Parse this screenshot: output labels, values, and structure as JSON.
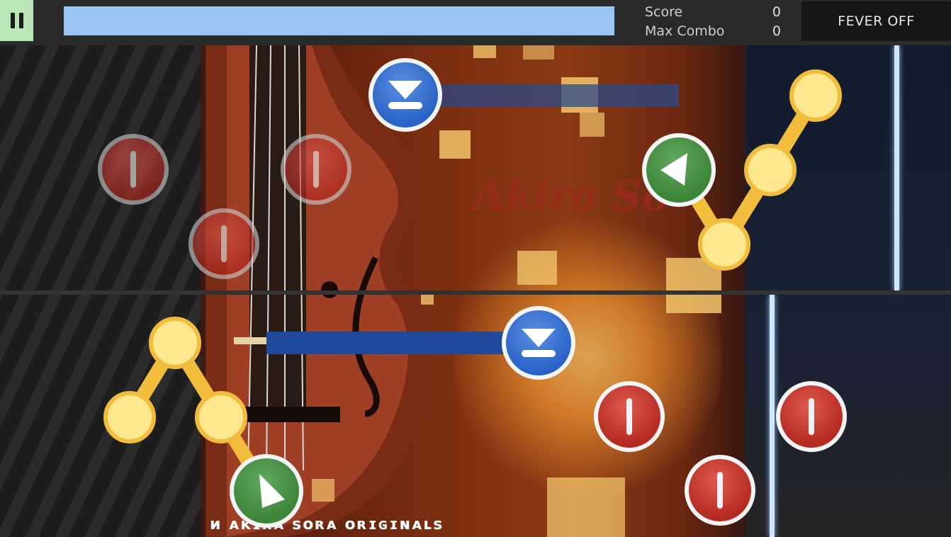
{
  "hud": {
    "pause_icon": "pause-icon",
    "score_label": "Score",
    "score_value": "0",
    "combo_label": "Max Combo",
    "combo_value": "0",
    "fever_label": "FEVER OFF",
    "song_progress": 1.0
  },
  "background": {
    "title_text": "Akira So",
    "credit_text": "ᴎ ᴀᴋɪʀᴀ sᴏʀᴀ ᴏʀɪɢɪɴᴀʟs"
  },
  "colors": {
    "pause_bg": "#b8e6b4",
    "progress": "#99c5f2",
    "tap_note": "#c0352c",
    "hold_note": "#2f6bd0",
    "flick_note": "#4a9246",
    "slide_note": "#fde88f",
    "slide_rim": "#f2bd3c"
  }
}
